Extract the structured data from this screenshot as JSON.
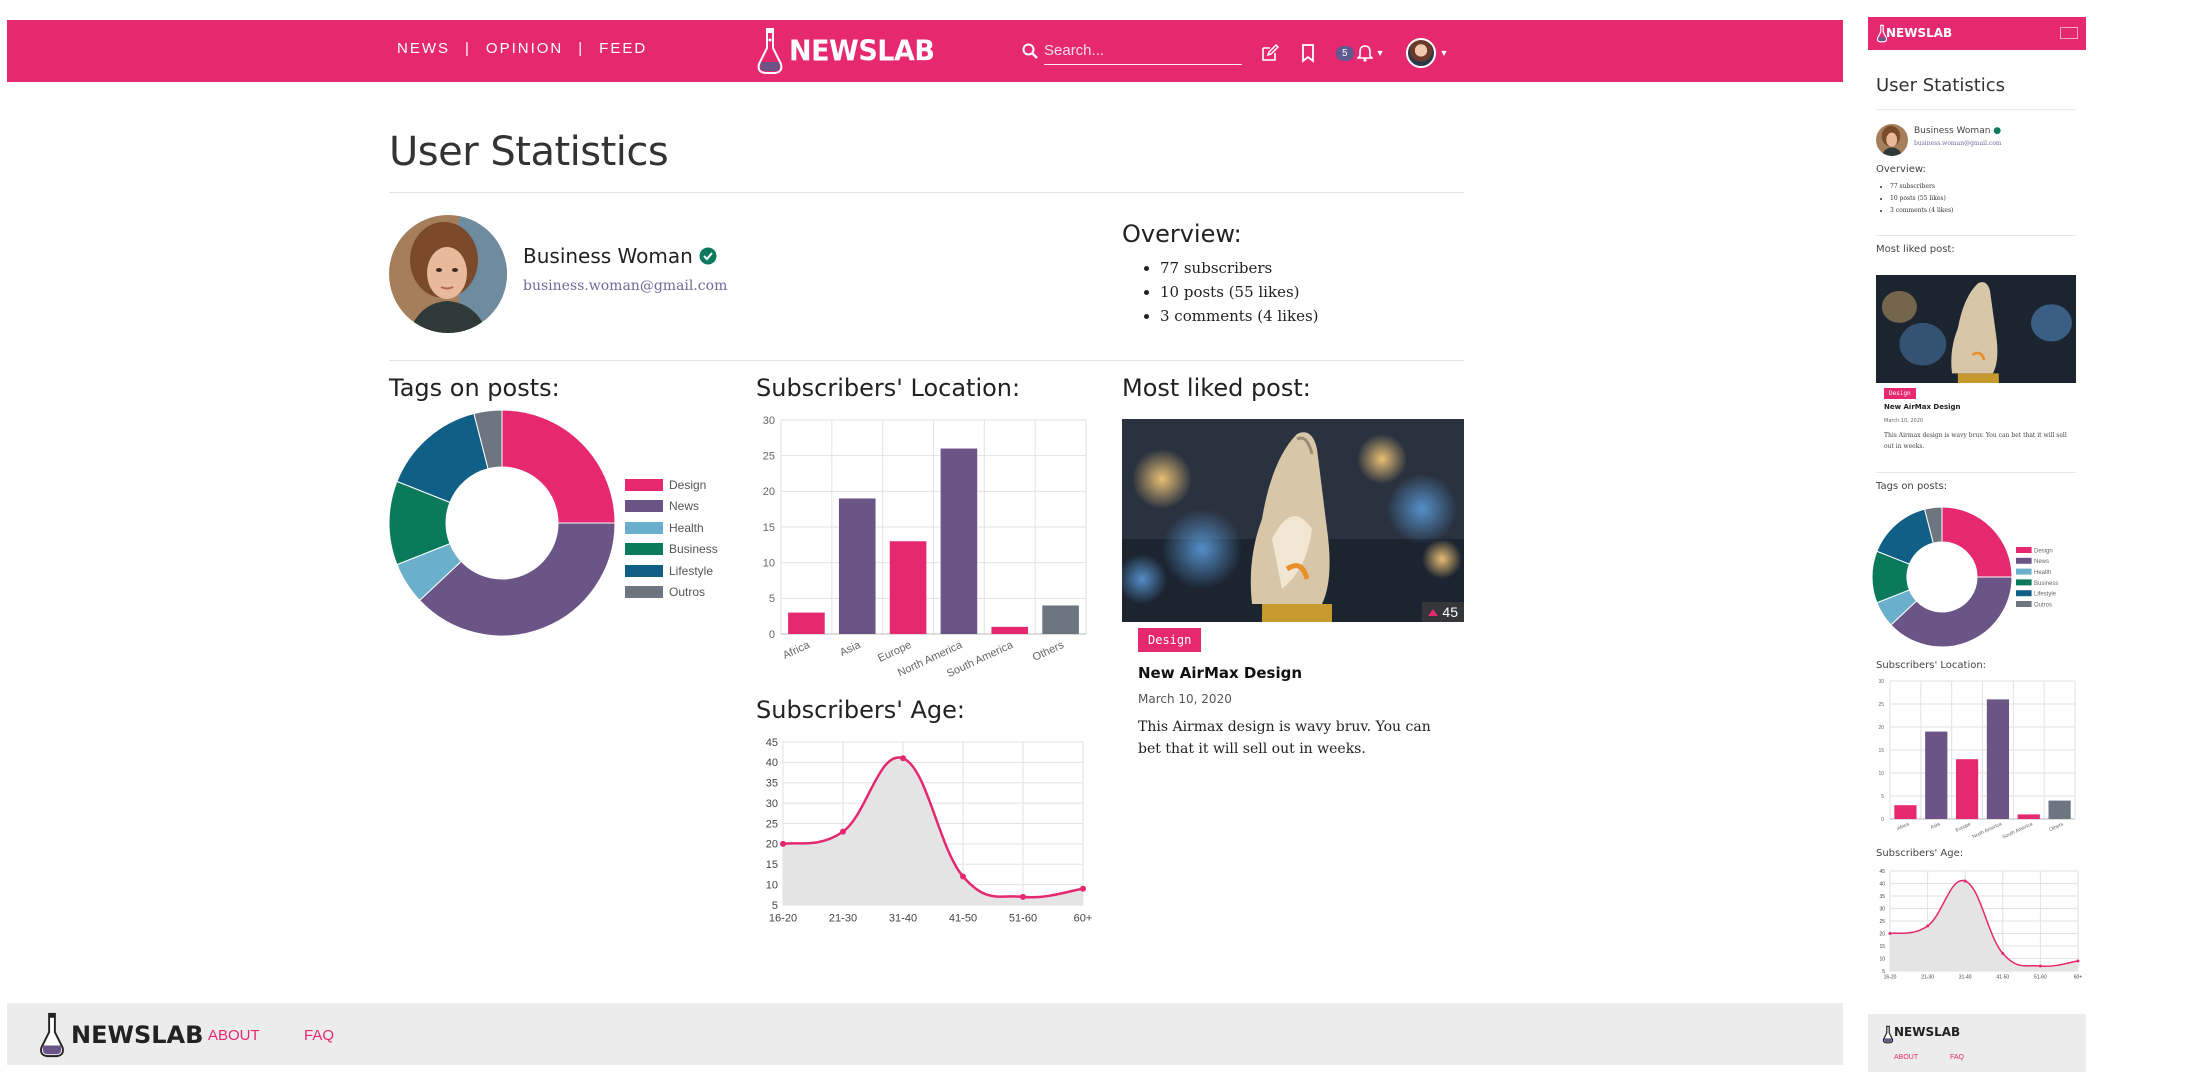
{
  "nav": {
    "links": [
      "NEWS",
      "OPINION",
      "FEED"
    ],
    "separator": "|",
    "brand": "NEWSLAB",
    "search_placeholder": "Search...",
    "notif_count": "5"
  },
  "page": {
    "title": "User Statistics"
  },
  "profile": {
    "name": "Business Woman",
    "email": "business.woman@gmail.com"
  },
  "overview": {
    "title": "Overview:",
    "items": [
      "77 subscribers",
      "10 posts (55 likes)",
      "3 comments (4 likes)"
    ]
  },
  "sections": {
    "tags": "Tags on posts:",
    "location": "Subscribers' Location:",
    "age": "Subscribers' Age:",
    "liked": "Most liked post:"
  },
  "post": {
    "likes": "45",
    "tag": "Design",
    "title": "New AirMax Design",
    "date": "March 10, 2020",
    "description": "This Airmax design is wavy bruv. You can bet that it will sell out in weeks."
  },
  "footer": {
    "brand": "NEWSLAB",
    "links": [
      "ABOUT",
      "FAQ"
    ]
  },
  "mobile": {
    "overview_title": "Overview:",
    "liked_title": "Most liked post:"
  },
  "colors": {
    "accent": "#e5286f",
    "purple": "#6b5587",
    "teal": "#007a5e"
  },
  "chart_data": [
    {
      "type": "pie",
      "title": "Tags on posts:",
      "categories": [
        "Design",
        "News",
        "Health",
        "Business",
        "Lifestyle",
        "Outros"
      ],
      "values": [
        25,
        38,
        6,
        12,
        15,
        4
      ],
      "colors": [
        "#e5286f",
        "#6b5587",
        "#6ab0cc",
        "#0b7a5c",
        "#0f5f86",
        "#6c7580"
      ],
      "legend": "right"
    },
    {
      "type": "bar",
      "title": "Subscribers' Location:",
      "categories": [
        "Africa",
        "Asia",
        "Europe",
        "North America",
        "South America",
        "Others"
      ],
      "values": [
        3,
        19,
        13,
        26,
        1,
        4
      ],
      "colors": [
        "#e5286f",
        "#6b5587",
        "#e5286f",
        "#6b5587",
        "#e5286f",
        "#6c7580"
      ],
      "ylim": [
        0,
        30
      ],
      "yticks": [
        0,
        5,
        10,
        15,
        20,
        25,
        30
      ],
      "grid": true
    },
    {
      "type": "line",
      "title": "Subscribers' Age:",
      "x": [
        "16-20",
        "21-30",
        "31-40",
        "41-50",
        "51-60",
        "60+"
      ],
      "values": [
        20,
        23,
        41,
        12,
        7,
        9
      ],
      "ylim": [
        5,
        45
      ],
      "yticks": [
        5,
        10,
        15,
        20,
        25,
        30,
        35,
        40,
        45
      ],
      "color": "#e5286f",
      "fill": "#e4e4e4",
      "grid": true
    }
  ]
}
